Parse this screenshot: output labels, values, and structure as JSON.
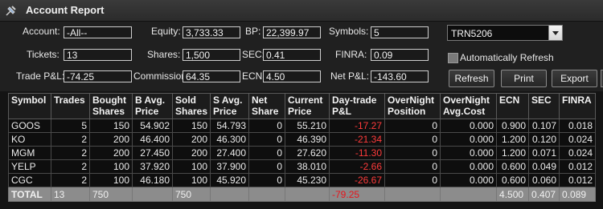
{
  "window": {
    "title": "Account Report"
  },
  "summary": {
    "account_label": "Account:",
    "account_value": "-All--",
    "equity_label": "Equity:",
    "equity_value": "3,733.33",
    "bp_label": "BP:",
    "bp_value": "22,399.97",
    "symbols_label": "Symbols:",
    "symbols_value": "5",
    "tickets_label": "Tickets:",
    "tickets_value": "13",
    "shares_label": "Shares:",
    "shares_value": "1,500",
    "sec_label": "SEC:",
    "sec_value": "0.41",
    "finra_label": "FINRA:",
    "finra_value": "0.09",
    "tradepl_label": "Trade P&L:",
    "tradepl_value": "-74.25",
    "commission_label": "Commission:",
    "commission_value": "64.35",
    "ecn_label": "ECN:",
    "ecn_value": "4.50",
    "netpl_label": "Net P&L:",
    "netpl_value": "-143.60"
  },
  "account_select": {
    "value": "TRN5206"
  },
  "auto_refresh": {
    "label": "Automatically Refresh",
    "checked": false
  },
  "buttons": {
    "refresh": "Refresh",
    "print": "Print",
    "export": "Export"
  },
  "table": {
    "headers": [
      "Symbol",
      "Trades",
      "Bought Shares",
      "B Avg. Price",
      "Sold Shares",
      "S Avg. Price",
      "Net Share",
      "Current Price",
      "Day-trade P&L",
      "OverNight Position",
      "OverNight Avg.Cost",
      "ECN",
      "SEC",
      "FINRA"
    ],
    "rows": [
      [
        "GOOS",
        "5",
        "150",
        "54.902",
        "150",
        "54.793",
        "0",
        "55.210",
        "-17.27",
        "0",
        "0.000",
        "0.900",
        "0.107",
        "0.018"
      ],
      [
        "KO",
        "2",
        "200",
        "46.400",
        "200",
        "46.300",
        "0",
        "46.390",
        "-21.34",
        "0",
        "0.000",
        "1.200",
        "0.120",
        "0.024"
      ],
      [
        "MGM",
        "2",
        "200",
        "27.450",
        "200",
        "27.400",
        "0",
        "27.620",
        "-11.30",
        "0",
        "0.000",
        "1.200",
        "0.071",
        "0.024"
      ],
      [
        "YELP",
        "2",
        "100",
        "37.920",
        "100",
        "37.900",
        "0",
        "38.010",
        "-2.66",
        "0",
        "0.000",
        "0.600",
        "0.049",
        "0.012"
      ],
      [
        "CGC",
        "2",
        "100",
        "46.180",
        "100",
        "45.920",
        "0",
        "45.230",
        "-26.67",
        "0",
        "0.000",
        "0.600",
        "0.060",
        "0.012"
      ]
    ],
    "total": [
      "TOTAL",
      "13",
      "750",
      "",
      "750",
      "",
      "",
      "",
      "-79.25",
      "",
      "",
      "4.500",
      "0.407",
      "0.089"
    ]
  },
  "colors": {
    "negative": "#ff3b3b",
    "total_row_bg": "#8c8c8c"
  },
  "icons": {
    "pin": "pin-icon",
    "dropdown": "chevron-down-icon"
  }
}
